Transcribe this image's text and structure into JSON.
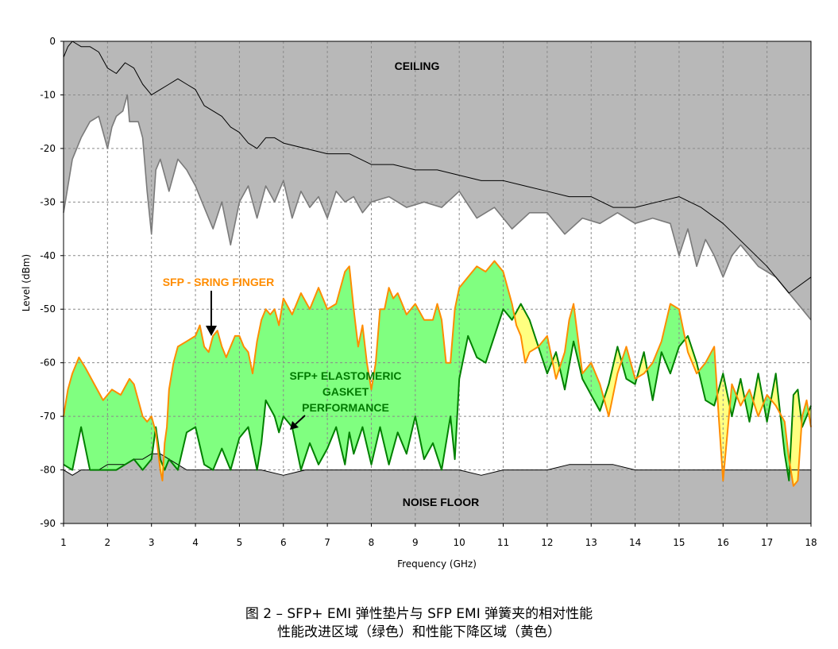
{
  "chart_data": {
    "type": "area",
    "xlabel": "Frequency (GHz)",
    "ylabel": "Level (dBm)",
    "xlim": [
      1,
      18
    ],
    "ylim": [
      -90,
      0
    ],
    "xticks": [
      "1",
      "2",
      "3",
      "4",
      "5",
      "6",
      "7",
      "8",
      "9",
      "10",
      "11",
      "12",
      "13",
      "14",
      "15",
      "16",
      "17",
      "18"
    ],
    "yticks": [
      "0",
      "-10",
      "-20",
      "-30",
      "-40",
      "-50",
      "-60",
      "-70",
      "-80",
      "-90"
    ],
    "grid": true,
    "annotations": {
      "ceiling": "CEILING",
      "noise_floor": "NOISE FLOOR",
      "sfp_finger": "SFP - SRING FINGER",
      "elastomeric_line1": "SFP+ ELASTOMERIC",
      "elastomeric_line2": "GASKET",
      "elastomeric_line3": "PERFORMANCE"
    },
    "colors": {
      "ceiling_fill": "#b8b8b8",
      "sfp_line": "#ff8c00",
      "elastomeric_line": "#008000",
      "improvement_fill": "#80ff80",
      "degradation_fill": "#ffff80",
      "ceiling_line": "#000000",
      "ceiling_ref_line": "#7a7a7a",
      "noise_line": "#000000"
    },
    "series": [
      {
        "name": "SFP - SRING FINGER",
        "x": [
          1.0,
          1.1,
          1.2,
          1.35,
          1.5,
          1.7,
          1.9,
          2.1,
          2.3,
          2.5,
          2.6,
          2.7,
          2.8,
          2.9,
          3.0,
          3.1,
          3.2,
          3.25,
          3.3,
          3.35,
          3.4,
          3.5,
          3.6,
          3.8,
          4.0,
          4.1,
          4.2,
          4.3,
          4.4,
          4.5,
          4.6,
          4.7,
          4.8,
          4.9,
          5.0,
          5.1,
          5.2,
          5.3,
          5.4,
          5.5,
          5.6,
          5.7,
          5.8,
          5.9,
          6.0,
          6.2,
          6.4,
          6.6,
          6.8,
          7.0,
          7.2,
          7.3,
          7.4,
          7.5,
          7.6,
          7.7,
          7.8,
          7.9,
          8.0,
          8.1,
          8.2,
          8.3,
          8.4,
          8.5,
          8.6,
          8.8,
          9.0,
          9.2,
          9.4,
          9.5,
          9.6,
          9.7,
          9.8,
          9.9,
          10.0,
          10.2,
          10.4,
          10.6,
          10.8,
          11.0,
          11.2,
          11.3,
          11.4,
          11.5,
          11.6,
          11.8,
          12.0,
          12.2,
          12.4,
          12.5,
          12.6,
          12.8,
          13.0,
          13.2,
          13.4,
          13.6,
          13.8,
          14.0,
          14.2,
          14.4,
          14.6,
          14.8,
          15.0,
          15.2,
          15.4,
          15.6,
          15.8,
          15.9,
          16.0,
          16.2,
          16.4,
          16.6,
          16.8,
          17.0,
          17.2,
          17.4,
          17.5,
          17.6,
          17.7,
          17.8,
          17.9,
          18.0
        ],
        "y": [
          -70,
          -65,
          -62,
          -59,
          -61,
          -64,
          -67,
          -65,
          -66,
          -63,
          -64,
          -67,
          -70,
          -71,
          -70,
          -73,
          -80,
          -82,
          -75,
          -72,
          -65,
          -60,
          -57,
          -56,
          -55,
          -53,
          -57,
          -58,
          -55,
          -54,
          -57,
          -59,
          -57,
          -55,
          -55,
          -57,
          -58,
          -62,
          -56,
          -52,
          -50,
          -51,
          -50,
          -53,
          -48,
          -51,
          -47,
          -50,
          -46,
          -50,
          -49,
          -46,
          -43,
          -42,
          -50,
          -57,
          -53,
          -60,
          -65,
          -60,
          -50,
          -50,
          -46,
          -48,
          -47,
          -51,
          -49,
          -52,
          -52,
          -49,
          -52,
          -60,
          -60,
          -50,
          -46,
          -44,
          -42,
          -43,
          -41,
          -43,
          -49,
          -53,
          -55,
          -60,
          -58,
          -57,
          -55,
          -63,
          -58,
          -52,
          -49,
          -62,
          -60,
          -64,
          -70,
          -62,
          -57,
          -63,
          -62,
          -60,
          -56,
          -49,
          -50,
          -58,
          -62,
          -60,
          -57,
          -70,
          -82,
          -64,
          -68,
          -65,
          -70,
          -66,
          -68,
          -71,
          -78,
          -83,
          -82,
          -70,
          -67,
          -72
        ],
        "color": "#ff8c00"
      },
      {
        "name": "SFP+ ELASTOMERIC GASKET PERFORMANCE",
        "x": [
          1.0,
          1.2,
          1.4,
          1.6,
          1.8,
          2.0,
          2.2,
          2.4,
          2.6,
          2.8,
          3.0,
          3.1,
          3.2,
          3.3,
          3.4,
          3.6,
          3.8,
          4.0,
          4.2,
          4.4,
          4.6,
          4.8,
          5.0,
          5.2,
          5.4,
          5.5,
          5.6,
          5.8,
          5.9,
          6.0,
          6.2,
          6.4,
          6.6,
          6.8,
          7.0,
          7.2,
          7.4,
          7.5,
          7.6,
          7.8,
          8.0,
          8.2,
          8.4,
          8.6,
          8.8,
          9.0,
          9.2,
          9.4,
          9.6,
          9.8,
          9.9,
          10.0,
          10.2,
          10.4,
          10.6,
          10.8,
          11.0,
          11.2,
          11.4,
          11.6,
          11.8,
          12.0,
          12.2,
          12.4,
          12.6,
          12.8,
          13.0,
          13.2,
          13.4,
          13.6,
          13.8,
          14.0,
          14.2,
          14.4,
          14.6,
          14.8,
          15.0,
          15.2,
          15.4,
          15.6,
          15.8,
          15.9,
          16.0,
          16.2,
          16.4,
          16.6,
          16.8,
          17.0,
          17.2,
          17.4,
          17.5,
          17.6,
          17.7,
          17.8,
          18.0
        ],
        "y": [
          -79,
          -80,
          -72,
          -80,
          -80,
          -80,
          -80,
          -79,
          -78,
          -80,
          -78,
          -72,
          -78,
          -80,
          -78,
          -80,
          -73,
          -72,
          -79,
          -80,
          -76,
          -80,
          -74,
          -72,
          -80,
          -75,
          -67,
          -70,
          -73,
          -70,
          -72,
          -80,
          -75,
          -79,
          -76,
          -72,
          -79,
          -73,
          -77,
          -72,
          -79,
          -72,
          -79,
          -73,
          -77,
          -70,
          -78,
          -75,
          -80,
          -70,
          -78,
          -63,
          -55,
          -59,
          -60,
          -55,
          -50,
          -52,
          -49,
          -52,
          -57,
          -62,
          -58,
          -65,
          -56,
          -63,
          -66,
          -69,
          -64,
          -57,
          -63,
          -64,
          -58,
          -67,
          -58,
          -62,
          -57,
          -55,
          -60,
          -67,
          -68,
          -65,
          -62,
          -70,
          -63,
          -71,
          -62,
          -71,
          -62,
          -77,
          -82,
          -66,
          -65,
          -72,
          -68
        ],
        "color": "#008000"
      },
      {
        "name": "ceiling",
        "x": [
          1.0,
          1.1,
          1.2,
          1.4,
          1.6,
          1.8,
          2.0,
          2.2,
          2.4,
          2.6,
          2.8,
          3.0,
          3.2,
          3.4,
          3.6,
          3.8,
          4.0,
          4.2,
          4.4,
          4.6,
          4.8,
          5.0,
          5.2,
          5.4,
          5.6,
          5.8,
          6.0,
          6.5,
          7.0,
          7.5,
          8.0,
          8.5,
          9.0,
          9.5,
          10.0,
          10.5,
          11.0,
          11.5,
          12.0,
          12.5,
          13.0,
          13.5,
          14.0,
          14.5,
          15.0,
          15.5,
          16.0,
          16.5,
          17.0,
          17.5,
          18.0
        ],
        "y": [
          -3,
          -1,
          0,
          -1,
          -1,
          -2,
          -5,
          -6,
          -4,
          -5,
          -8,
          -10,
          -9,
          -8,
          -7,
          -8,
          -9,
          -12,
          -13,
          -14,
          -16,
          -17,
          -19,
          -20,
          -18,
          -18,
          -19,
          -20,
          -21,
          -21,
          -23,
          -23,
          -24,
          -24,
          -25,
          -26,
          -26,
          -27,
          -28,
          -29,
          -29,
          -31,
          -31,
          -30,
          -29,
          -31,
          -34,
          -38,
          -42,
          -47,
          -44
        ],
        "color": "#000000"
      },
      {
        "name": "ceiling reference",
        "x": [
          1.0,
          1.2,
          1.4,
          1.6,
          1.8,
          2.0,
          2.1,
          2.2,
          2.35,
          2.45,
          2.5,
          2.7,
          2.8,
          2.9,
          3.0,
          3.1,
          3.2,
          3.4,
          3.6,
          3.8,
          4.0,
          4.2,
          4.4,
          4.6,
          4.8,
          5.0,
          5.2,
          5.4,
          5.6,
          5.8,
          6.0,
          6.2,
          6.4,
          6.6,
          6.8,
          7.0,
          7.2,
          7.4,
          7.6,
          7.8,
          8.0,
          8.4,
          8.8,
          9.2,
          9.6,
          10.0,
          10.4,
          10.8,
          11.2,
          11.6,
          12.0,
          12.4,
          12.8,
          13.2,
          13.6,
          14.0,
          14.4,
          14.8,
          15.0,
          15.2,
          15.4,
          15.6,
          15.8,
          16.0,
          16.2,
          16.4,
          16.8,
          17.2,
          17.6,
          18.0
        ],
        "y": [
          -32,
          -22,
          -18,
          -15,
          -14,
          -20,
          -16,
          -14,
          -13,
          -10,
          -15,
          -15,
          -18,
          -28,
          -36,
          -24,
          -22,
          -28,
          -22,
          -24,
          -27,
          -31,
          -35,
          -30,
          -38,
          -30,
          -27,
          -33,
          -27,
          -30,
          -26,
          -33,
          -28,
          -31,
          -29,
          -33,
          -28,
          -30,
          -29,
          -32,
          -30,
          -29,
          -31,
          -30,
          -31,
          -28,
          -33,
          -31,
          -35,
          -32,
          -32,
          -36,
          -33,
          -34,
          -32,
          -34,
          -33,
          -34,
          -40,
          -35,
          -42,
          -37,
          -40,
          -44,
          -40,
          -38,
          -42,
          -44,
          -48,
          -52
        ],
        "color": "#7a7a7a"
      },
      {
        "name": "noise floor",
        "x": [
          1.0,
          1.2,
          1.4,
          1.6,
          1.8,
          2.0,
          2.2,
          2.4,
          2.6,
          2.8,
          3.0,
          3.2,
          3.4,
          3.6,
          3.8,
          4.0,
          4.5,
          5.0,
          5.5,
          6.0,
          6.5,
          7.0,
          7.5,
          8.0,
          8.5,
          9.0,
          9.5,
          10.0,
          10.5,
          11.0,
          11.5,
          12.0,
          12.5,
          13.0,
          13.5,
          14.0,
          14.5,
          15.0,
          15.5,
          16.0,
          16.5,
          17.0,
          17.5,
          18.0
        ],
        "y": [
          -80,
          -81,
          -80,
          -80,
          -80,
          -79,
          -79,
          -79,
          -78,
          -78,
          -77,
          -77,
          -78,
          -79,
          -80,
          -80,
          -80,
          -80,
          -80,
          -81,
          -80,
          -80,
          -80,
          -80,
          -80,
          -80,
          -80,
          -80,
          -81,
          -80,
          -80,
          -80,
          -79,
          -79,
          -79,
          -80,
          -80,
          -80,
          -80,
          -80,
          -80,
          -80,
          -80,
          -80
        ],
        "color": "#000000"
      }
    ]
  },
  "caption": {
    "line1": "图 2 – SFP+ EMI 弹性垫片与 SFP EMI 弹簧夹的相对性能",
    "line2": "性能改进区域（绿色）和性能下降区域（黄色）"
  }
}
